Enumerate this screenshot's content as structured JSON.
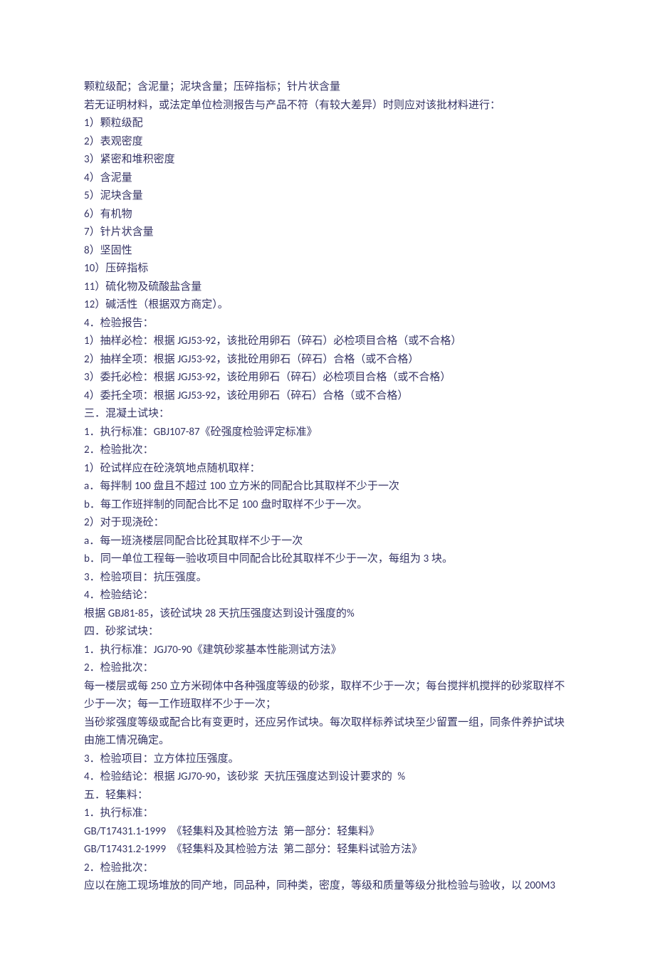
{
  "lines": [
    "颗粒级配；含泥量；泥块含量；压碎指标；针片状含量",
    "若无证明材料，或法定单位检测报告与产品不符（有较大差异）时则应对该批材料进行：",
    "1）颗粒级配",
    "2）表观密度",
    "3）紧密和堆积密度",
    "4）含泥量",
    "5）泥块含量",
    "6）有机物",
    "7）针片状含量",
    "8）坚固性",
    "10）压碎指标",
    "11）硫化物及硫酸盐含量",
    "12）碱活性（根据双方商定）。",
    "4．检验报告：",
    "1）抽样必检：根据 JGJ53-92，该批砼用卵石（碎石）必检项目合格（或不合格）",
    "2）抽样全项：根据 JGJ53-92，该批砼用卵石（碎石）合格（或不合格）",
    "3）委托必检：根据 JGJ53-92，该砼用卵石（碎石）必检项目合格（或不合格）",
    "4）委托全项：根据 JGJ53-92，该砼用卵石（碎石）合格（或不合格）",
    "三．混凝土试块：",
    "1．执行标准：GBJ107-87《砼强度检验评定标准》",
    "2．检验批次：",
    "1）砼试样应在砼浇筑地点随机取样：",
    "a．每拌制 100 盘且不超过 100 立方米的同配合比其取样不少于一次",
    "b．每工作班拌制的同配合比不足 100 盘时取样不少于一次。",
    "2）对于现浇砼：",
    "a．每一班浇楼层同配合比砼其取样不少于一次",
    "b．同一单位工程每一验收项目中同配合比砼其取样不少于一次，每组为 3 块。",
    "3．检验项目：抗压强度。",
    "4．检验结论：",
    "根据 GBJ81-85，该砼试块 28 天抗压强度达到设计强度的%",
    "四．砂浆试块：",
    "1．执行标准：JGJ70-90《建筑砂浆基本性能测试方法》",
    "2．检验批次：",
    "每一楼层或每 250 立方米砌体中各种强度等级的砂浆，取样不少于一次；每台搅拌机搅拌的砂浆取样不少于一次；每一工作班取样不少于一次；",
    "当砂浆强度等级或配合比有变更时，还应另作试块。每次取样标养试块至少留置一组，同条件养护试块由施工情况确定。",
    "3．检验项目：立方体拉压强度。",
    "4．检验结论：根据 JGJ70-90，该砂浆  天抗压强度达到设计要求的  %",
    "五．轻集料：",
    "1．执行标准：",
    "GB/T17431.1-1999  《轻集料及其检验方法  第一部分：轻集料》",
    "GB/T17431.2-1999  《轻集料及其检验方法  第二部分：轻集料试验方法》",
    "2．检验批次：",
    "应以在施工现场堆放的同产地，同品种，同种类，密度，等级和质量等级分批检验与验收，以 200M3"
  ]
}
